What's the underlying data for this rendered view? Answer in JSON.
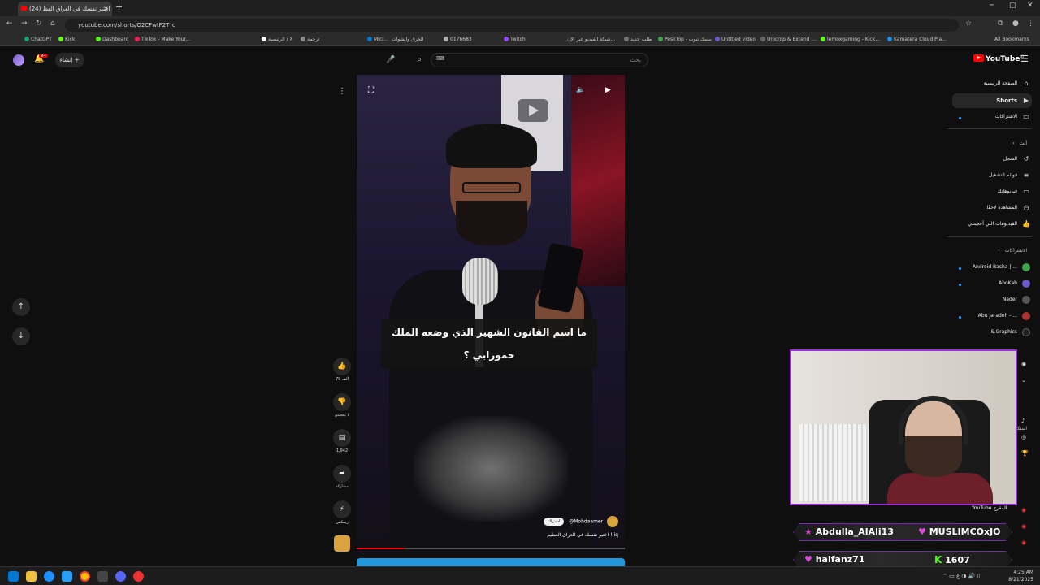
{
  "browser": {
    "tab_title": "(24) اختبر نفسك في العراق العظ",
    "url": "youtube.com/shorts/O2CFwtF2T_c",
    "all_bookmarks": "All Bookmarks",
    "bookmarks": [
      "ChatGPT",
      "Kick",
      "Kick",
      "Dashboard",
      "TikTok - Make Your...",
      "الرئيسية / X",
      "ترجمة",
      "Micr...",
      "الحرق والشوات",
      "0176683",
      "Twitch",
      "شبكة الفيديو عبر الإن...",
      "طلب جديد",
      "PeskTop - بيسك تبوب",
      "Untitled video",
      "Unicrop & Extend I...",
      "lemoxgaming - Kick...",
      "Kamatera Cloud Pla..."
    ]
  },
  "header": {
    "create_label": "إنشاء",
    "notif_count": "9+",
    "search_placeholder": "بحث",
    "logo_text": "YouTube",
    "logo_sup": "IQ"
  },
  "sidebar": {
    "home": "الصفحة الرئيسية",
    "shorts": "Shorts",
    "subscriptions": "الاشتراكات",
    "you_head": "أنت",
    "history": "السجل",
    "playlists": "قوائم التشغيل",
    "your_videos": "فيديوهاتك",
    "watch_later": "المشاهدة لاحقًا",
    "liked": "الفيديوهات التي أعجبتني",
    "subs_head": "الاشتراكات",
    "channels": [
      "Android Basha | ...",
      "AboKab",
      "Nader",
      "Abu Jaradeh - ...",
      "S.Graphics"
    ],
    "explore": "استكشاف",
    "more_from": "المزيد من YouTube"
  },
  "shorts": {
    "caption_line1": "ما اسم القانون الشهير الذي وضعه الملك",
    "caption_line2": "حمورابي ؟",
    "channel_handle": "@Mohdaamer",
    "subscribe_label": "اشتراك",
    "video_title": "اختبر نفسك في العراق العظيم ! iq",
    "progress": 0.18,
    "likes": "79 ألف",
    "dislike_label": "لا يعجبني",
    "comments": "1,942",
    "share_label": "مشاركة",
    "remix_label": "ريمكس"
  },
  "stream_overlay": {
    "cam_label": "YouTube المقرح",
    "chat": [
      {
        "user": "Abdulla_AlAli13",
        "user2": "MUSLIMCOxJO"
      },
      {
        "user": "haifanz71",
        "kick_count": "1607"
      }
    ]
  },
  "taskbar": {
    "time": "4:25 AM",
    "date": "8/21/2025"
  }
}
